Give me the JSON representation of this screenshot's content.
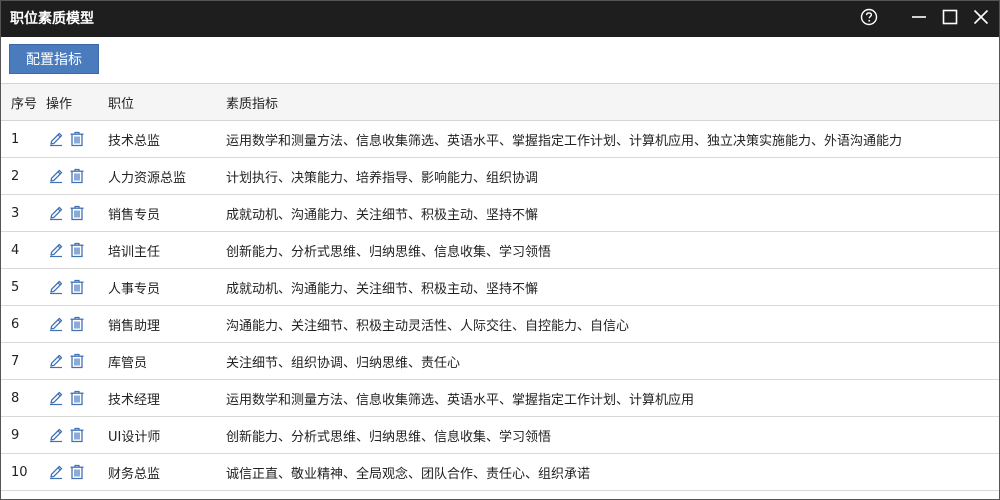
{
  "window": {
    "title": "职位素质模型"
  },
  "toolbar": {
    "config_label": "配置指标"
  },
  "table": {
    "headers": {
      "index": "序号",
      "ops": "操作",
      "position": "职位",
      "qualities": "素质指标"
    },
    "rows": [
      {
        "index": "1",
        "position": "技术总监",
        "qualities": "运用数学和测量方法、信息收集筛选、英语水平、掌握指定工作计划、计算机应用、独立决策实施能力、外语沟通能力"
      },
      {
        "index": "2",
        "position": "人力资源总监",
        "qualities": "计划执行、决策能力、培养指导、影响能力、组织协调"
      },
      {
        "index": "3",
        "position": "销售专员",
        "qualities": "成就动机、沟通能力、关注细节、积极主动、坚持不懈"
      },
      {
        "index": "4",
        "position": "培训主任",
        "qualities": "创新能力、分析式思维、归纳思维、信息收集、学习领悟"
      },
      {
        "index": "5",
        "position": "人事专员",
        "qualities": "成就动机、沟通能力、关注细节、积极主动、坚持不懈"
      },
      {
        "index": "6",
        "position": "销售助理",
        "qualities": "沟通能力、关注细节、积极主动灵活性、人际交往、自控能力、自信心"
      },
      {
        "index": "7",
        "position": "库管员",
        "qualities": "关注细节、组织协调、归纳思维、责任心"
      },
      {
        "index": "8",
        "position": "技术经理",
        "qualities": "运用数学和测量方法、信息收集筛选、英语水平、掌握指定工作计划、计算机应用"
      },
      {
        "index": "9",
        "position": "UI设计师",
        "qualities": "创新能力、分析式思维、归纳思维、信息收集、学习领悟"
      },
      {
        "index": "10",
        "position": "财务总监",
        "qualities": "诚信正直、敬业精神、全局观念、团队合作、责任心、组织承诺"
      }
    ]
  },
  "icons": {
    "edit": "pencil-icon",
    "delete": "trash-icon"
  },
  "colors": {
    "titlebar": "#1e1e1e",
    "accent": "#4a7bbd",
    "icon": "#3f72b5"
  }
}
